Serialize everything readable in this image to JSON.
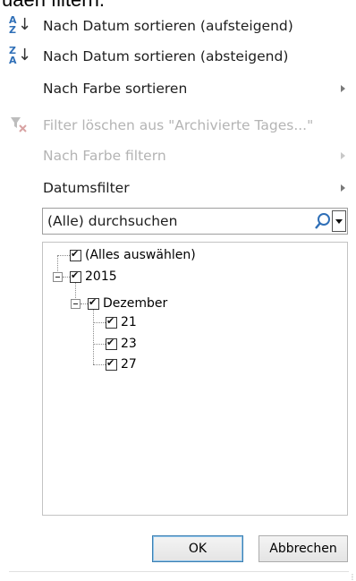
{
  "cut_heading": "uaen filtern.",
  "menu": {
    "sort_asc": {
      "label": "Nach Datum sortieren (aufsteigend)",
      "icon": "sort-ascending-icon"
    },
    "sort_desc": {
      "label": "Nach Datum sortieren (absteigend)",
      "icon": "sort-descending-icon"
    },
    "sort_color": {
      "label": "Nach Farbe sortieren",
      "icon": "submenu-arrow-icon"
    },
    "clear_filter": {
      "label": "Filter löschen aus \"Archivierte Tages...\"",
      "icon": "clear-filter-icon"
    },
    "filter_color": {
      "label": "Nach Farbe filtern",
      "icon": "submenu-arrow-icon"
    },
    "date_filter": {
      "label": "Datumsfilter",
      "icon": "submenu-arrow-icon"
    }
  },
  "search": {
    "placeholder": "(Alle) durchsuchen",
    "icon": "search-icon"
  },
  "tree": {
    "select_all": "(Alles auswählen)",
    "year": "2015",
    "month": "Dezember",
    "days": [
      "21",
      "23",
      "27"
    ]
  },
  "buttons": {
    "ok": "OK",
    "cancel": "Abbrechen"
  },
  "colors": {
    "accent_blue": "#2f6fb7",
    "disabled_text": "#b4b4b4"
  }
}
